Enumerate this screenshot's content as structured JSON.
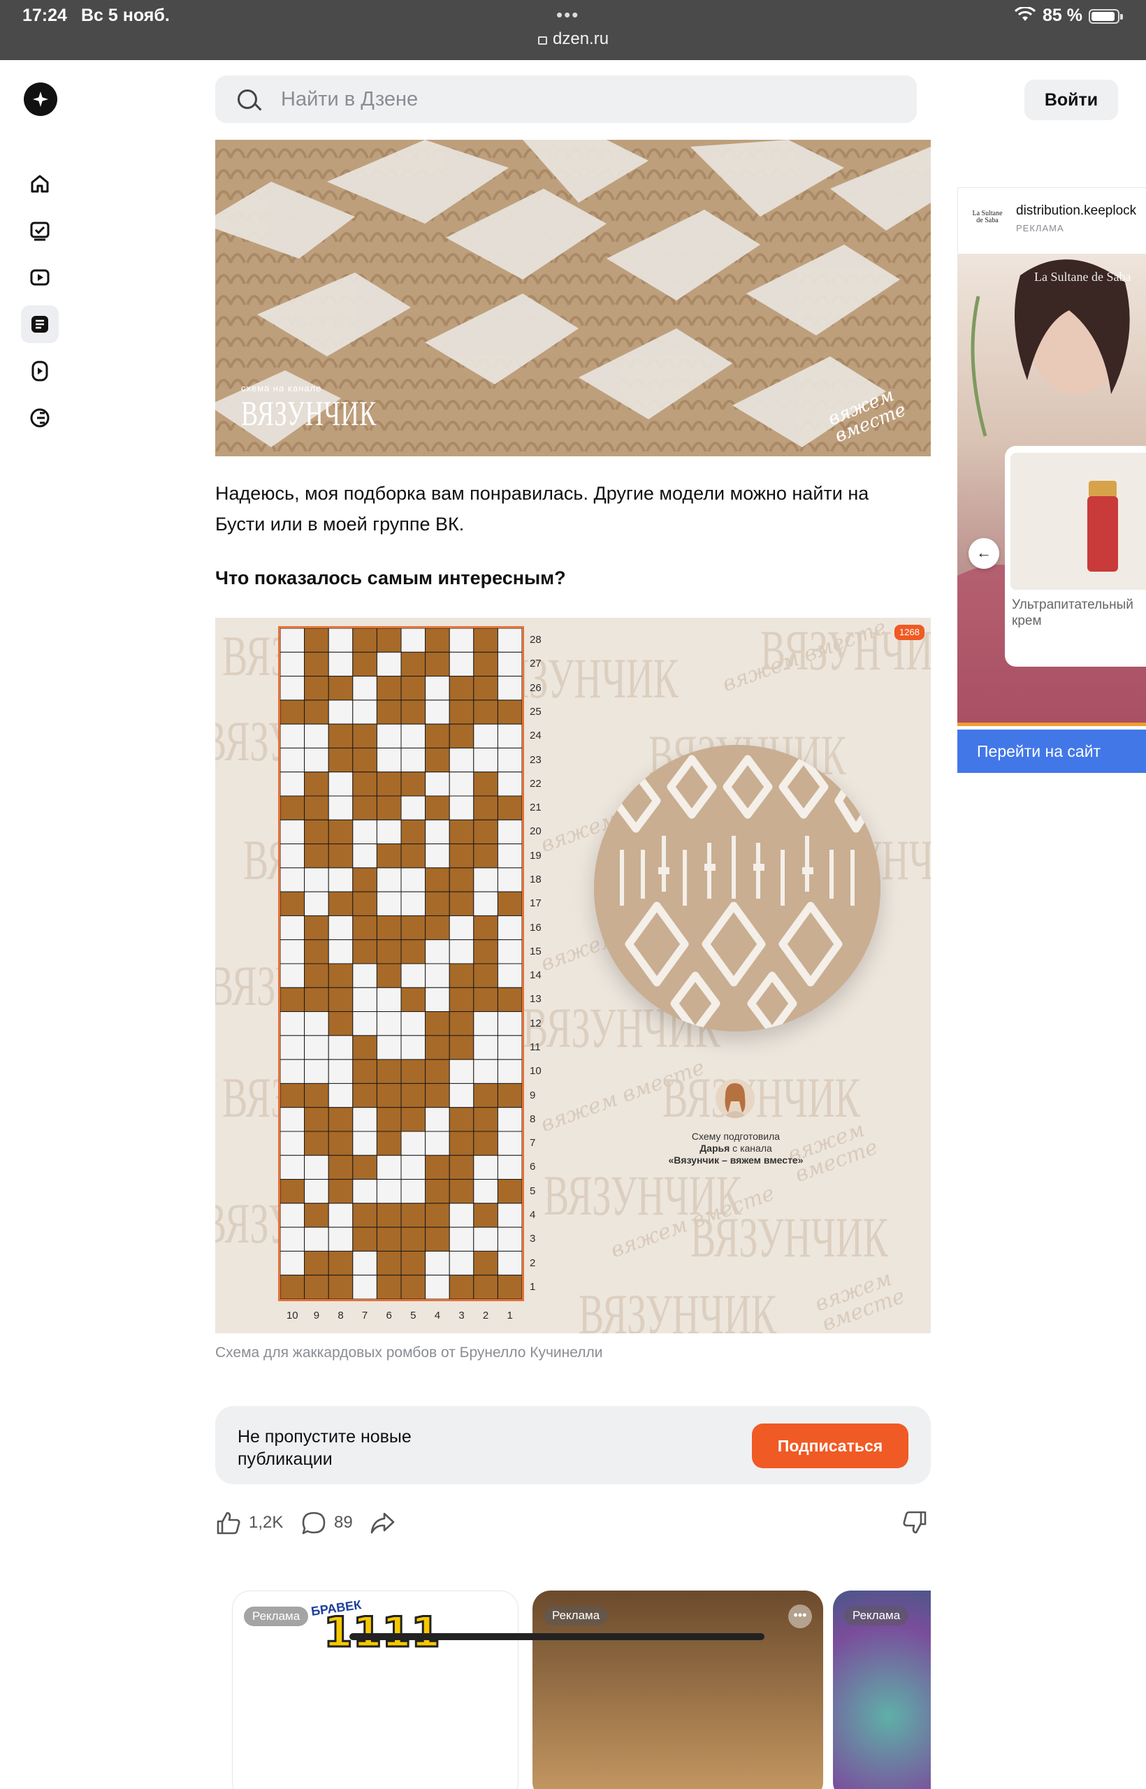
{
  "statusbar": {
    "time": "17:24",
    "date": "Вс 5 нояб.",
    "url": "dzen.ru",
    "battery": "85 %"
  },
  "header": {
    "search_placeholder": "Найти в Дзене",
    "login_label": "Войти"
  },
  "rail": [
    "home-icon",
    "tasks-icon",
    "video-icon",
    "articles-icon",
    "shorts-icon",
    "media-icon"
  ],
  "article": {
    "photo1": {
      "brand_small": "схема на канале",
      "brand_big": "ВЯЗУНЧИК",
      "stamp": "вяжем вместе"
    },
    "paragraph1": "Надеюсь, моя подборка вам понравилась. Другие модели можно найти на Бусти или в моей группе ВК.",
    "paragraph2": "Что показалось самым интересным?",
    "chart": {
      "badge": "1268",
      "watermark": "ВЯЗУНЧИК",
      "watermark_script": "вяжем вместе",
      "row_numbers": [
        "28",
        "27",
        "26",
        "25",
        "24",
        "23",
        "22",
        "21",
        "20",
        "19",
        "18",
        "17",
        "16",
        "15",
        "14",
        "13",
        "12",
        "11",
        "10",
        "9",
        "8",
        "7",
        "6",
        "5",
        "4",
        "3",
        "2",
        "1"
      ],
      "col_numbers": [
        "10",
        "9",
        "8",
        "7",
        "6",
        "5",
        "4",
        "3",
        "2",
        "1"
      ],
      "credit_line1": "Схему подготовила",
      "credit_name": "Дарья",
      "credit_line2": " с канала",
      "credit_channel": "«Вязунчик – вяжем вместе»",
      "colors": {
        "brown": "#a86a28",
        "white": "#f4f4f4",
        "frame": "#e2733a"
      }
    },
    "caption": "Схема для жаккардовых ромбов от Брунелло Кучинелли"
  },
  "subscribe": {
    "text": "Не пропустите новые публикации",
    "button": "Подписаться"
  },
  "actions": {
    "likes": "1,2K",
    "comments": "89"
  },
  "ads_row": [
    {
      "tag": "Реклама",
      "logo": "1111",
      "sub": "БРАВЕК"
    },
    {
      "tag": "Реклама"
    },
    {
      "tag": "Реклама"
    }
  ],
  "side_ad": {
    "domain": "distribution.keeplock",
    "label": "РЕКЛАМА",
    "mini_logo": "La Sultane de Saba",
    "brand": "La Sultane de Saba",
    "card_text": "Ультрапитательный крем",
    "cta": "Перейти на сайт"
  }
}
